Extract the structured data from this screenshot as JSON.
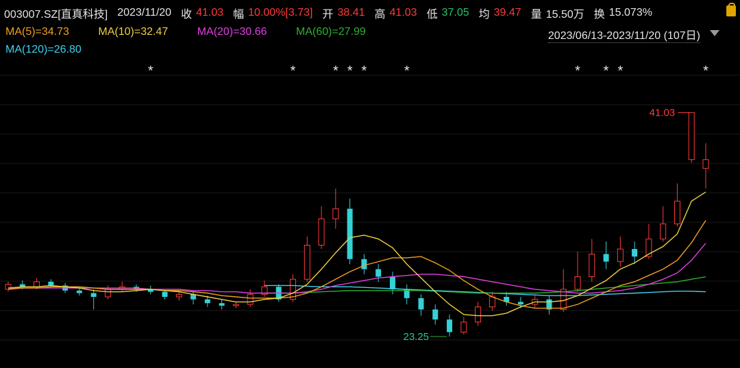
{
  "header": {
    "code": "003007.SZ[直真科技]",
    "date": "2023/11/20",
    "close_label": "收",
    "close": "41.03",
    "change_label": "幅",
    "change": "10.00%[3.73]",
    "open_label": "开",
    "open": "38.41",
    "high_label": "高",
    "high": "41.03",
    "low_label": "低",
    "low": "37.05",
    "avg_label": "均",
    "avg": "39.47",
    "volume_label": "量",
    "volume": "15.50万",
    "turnover_label": "换",
    "turnover": "15.073%"
  },
  "indicators": {
    "ma5": "MA(5)=34.73",
    "ma10": "MA(10)=32.47",
    "ma20": "MA(20)=30.66",
    "ma60": "MA(60)=27.99",
    "ma120": "MA(120)=26.80"
  },
  "range_label": "2023/06/13-2023/11/20 (107日)",
  "colors": {
    "up": "#ff3b3b",
    "down": "#34d1d6",
    "ma5": "#f0d040",
    "ma10": "#f0a020",
    "ma20": "#e040e0",
    "ma60": "#2fb02f",
    "ma120": "#40d0f0"
  },
  "chart_data": {
    "type": "candlestick",
    "ylim": [
      22,
      44
    ],
    "high_marker": "41.03",
    "low_marker": "23.25",
    "asterisk_positions": [
      10,
      20,
      23,
      24,
      25,
      28,
      40,
      42,
      43,
      49
    ],
    "candles": [
      [
        27.0,
        27.4,
        27.6,
        26.8
      ],
      [
        27.4,
        27.2,
        27.7,
        27.0
      ],
      [
        27.2,
        27.6,
        27.9,
        27.0
      ],
      [
        27.6,
        27.3,
        27.8,
        27.1
      ],
      [
        27.3,
        26.9,
        27.5,
        26.7
      ],
      [
        26.9,
        26.7,
        27.2,
        26.5
      ],
      [
        26.7,
        26.4,
        27.0,
        25.4
      ],
      [
        26.4,
        27.0,
        27.3,
        26.2
      ],
      [
        27.0,
        27.2,
        27.6,
        26.8
      ],
      [
        27.2,
        27.0,
        27.4,
        26.8
      ],
      [
        27.0,
        26.8,
        27.3,
        26.6
      ],
      [
        26.8,
        26.4,
        27.0,
        26.2
      ],
      [
        26.4,
        26.6,
        26.9,
        26.1
      ],
      [
        26.6,
        26.2,
        26.8,
        25.8
      ],
      [
        26.2,
        25.9,
        26.5,
        25.6
      ],
      [
        25.9,
        25.7,
        26.2,
        25.4
      ],
      [
        25.7,
        25.8,
        26.0,
        25.5
      ],
      [
        25.8,
        26.6,
        27.0,
        25.6
      ],
      [
        26.6,
        27.2,
        27.7,
        26.4
      ],
      [
        27.2,
        26.2,
        27.4,
        26.0
      ],
      [
        26.2,
        27.8,
        28.2,
        26.0
      ],
      [
        27.8,
        30.5,
        31.2,
        27.6
      ],
      [
        30.5,
        32.6,
        33.6,
        30.2
      ],
      [
        32.6,
        33.4,
        35.0,
        31.8
      ],
      [
        33.4,
        29.4,
        34.2,
        29.0
      ],
      [
        29.4,
        28.6,
        29.8,
        28.2
      ],
      [
        28.6,
        28.0,
        29.0,
        27.6
      ],
      [
        28.0,
        27.0,
        28.4,
        26.6
      ],
      [
        27.0,
        26.3,
        27.4,
        25.8
      ],
      [
        26.3,
        25.4,
        26.6,
        24.9
      ],
      [
        25.4,
        24.6,
        25.8,
        24.2
      ],
      [
        24.6,
        23.6,
        25.0,
        23.25
      ],
      [
        23.6,
        24.4,
        24.8,
        23.4
      ],
      [
        24.4,
        25.6,
        26.0,
        24.1
      ],
      [
        25.6,
        26.4,
        26.8,
        25.3
      ],
      [
        26.4,
        26.0,
        26.8,
        25.7
      ],
      [
        26.0,
        25.8,
        26.4,
        25.5
      ],
      [
        25.8,
        26.2,
        26.6,
        25.5
      ],
      [
        26.2,
        25.4,
        26.5,
        25.0
      ],
      [
        25.4,
        27.0,
        28.6,
        25.2
      ],
      [
        27.0,
        28.0,
        30.0,
        26.8
      ],
      [
        28.0,
        29.8,
        31.0,
        27.6
      ],
      [
        29.8,
        29.2,
        30.8,
        28.6
      ],
      [
        29.2,
        30.2,
        31.2,
        28.8
      ],
      [
        30.2,
        29.6,
        30.8,
        29.0
      ],
      [
        29.6,
        31.0,
        32.2,
        29.4
      ],
      [
        31.0,
        32.2,
        33.6,
        30.8
      ],
      [
        32.2,
        34.0,
        35.4,
        32.0
      ],
      [
        37.3,
        41.03,
        41.03,
        37.05
      ],
      [
        36.6,
        37.3,
        38.6,
        35.0
      ]
    ],
    "ma5": [
      27.1,
      27.2,
      27.2,
      27.3,
      27.2,
      27.1,
      26.9,
      26.8,
      26.8,
      26.9,
      27.0,
      26.9,
      26.8,
      26.6,
      26.4,
      26.2,
      26.0,
      26.0,
      26.2,
      26.3,
      26.7,
      27.4,
      28.6,
      29.9,
      31.1,
      31.3,
      31.0,
      30.3,
      29.0,
      27.9,
      26.8,
      25.8,
      25.0,
      24.9,
      24.9,
      25.1,
      25.6,
      26.0,
      26.0,
      26.1,
      26.5,
      27.1,
      27.7,
      28.6,
      29.1,
      29.8,
      30.4,
      31.4,
      34.0,
      34.73
    ],
    "ma10": [
      27.0,
      27.1,
      27.1,
      27.2,
      27.2,
      27.2,
      27.1,
      27.0,
      27.0,
      27.0,
      27.0,
      26.9,
      26.9,
      26.8,
      26.7,
      26.5,
      26.4,
      26.3,
      26.3,
      26.3,
      26.4,
      26.7,
      27.2,
      27.8,
      28.4,
      28.9,
      29.2,
      29.5,
      29.5,
      29.6,
      29.1,
      28.5,
      27.7,
      27.0,
      26.4,
      26.0,
      25.7,
      25.5,
      25.5,
      25.5,
      25.8,
      26.3,
      26.8,
      27.3,
      27.6,
      28.1,
      28.6,
      29.3,
      30.7,
      32.47
    ],
    "ma20": [
      27.1,
      27.1,
      27.1,
      27.1,
      27.1,
      27.1,
      27.1,
      27.1,
      27.1,
      27.1,
      27.0,
      27.0,
      27.0,
      26.9,
      26.9,
      26.8,
      26.8,
      26.7,
      26.7,
      26.7,
      26.7,
      26.8,
      27.0,
      27.3,
      27.5,
      27.7,
      27.9,
      28.0,
      28.1,
      28.2,
      28.2,
      28.1,
      28.0,
      27.8,
      27.6,
      27.4,
      27.2,
      27.0,
      26.9,
      26.8,
      26.7,
      26.7,
      26.8,
      26.9,
      27.1,
      27.4,
      27.8,
      28.3,
      29.3,
      30.66
    ],
    "ma60": [
      null,
      null,
      null,
      null,
      null,
      null,
      null,
      null,
      null,
      null,
      null,
      null,
      null,
      null,
      null,
      null,
      null,
      null,
      26.7,
      26.7,
      26.7,
      26.75,
      26.8,
      26.85,
      26.9,
      26.9,
      26.9,
      26.9,
      26.9,
      26.9,
      26.85,
      26.8,
      26.75,
      26.7,
      26.7,
      26.7,
      26.7,
      26.7,
      26.75,
      26.8,
      26.9,
      27.0,
      27.1,
      27.2,
      27.3,
      27.4,
      27.5,
      27.6,
      27.8,
      27.99
    ],
    "ma120": [
      null,
      null,
      null,
      null,
      null,
      null,
      null,
      null,
      null,
      null,
      null,
      null,
      null,
      null,
      null,
      null,
      null,
      null,
      27.3,
      27.3,
      27.3,
      27.25,
      27.2,
      27.2,
      27.2,
      27.15,
      27.1,
      27.05,
      27.0,
      26.95,
      26.9,
      26.85,
      26.8,
      26.75,
      26.7,
      26.65,
      26.6,
      26.55,
      26.5,
      26.5,
      26.5,
      26.55,
      26.6,
      26.65,
      26.7,
      26.75,
      26.8,
      26.85,
      26.85,
      26.8
    ]
  }
}
